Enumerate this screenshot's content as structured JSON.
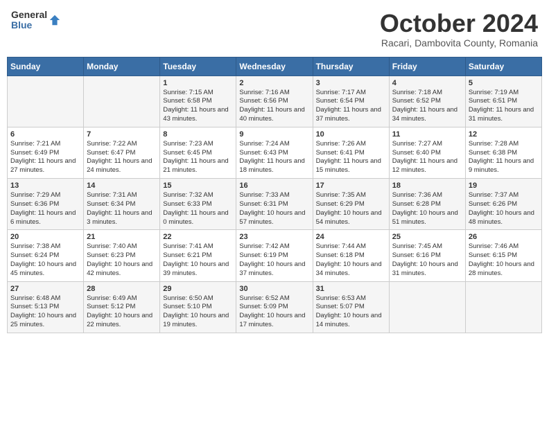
{
  "header": {
    "logo": {
      "line1": "General",
      "line2": "Blue"
    },
    "title": "October 2024",
    "subtitle": "Racari, Dambovita County, Romania"
  },
  "weekdays": [
    "Sunday",
    "Monday",
    "Tuesday",
    "Wednesday",
    "Thursday",
    "Friday",
    "Saturday"
  ],
  "weeks": [
    [
      {
        "day": "",
        "content": ""
      },
      {
        "day": "",
        "content": ""
      },
      {
        "day": "1",
        "content": "Sunrise: 7:15 AM\nSunset: 6:58 PM\nDaylight: 11 hours and 43 minutes."
      },
      {
        "day": "2",
        "content": "Sunrise: 7:16 AM\nSunset: 6:56 PM\nDaylight: 11 hours and 40 minutes."
      },
      {
        "day": "3",
        "content": "Sunrise: 7:17 AM\nSunset: 6:54 PM\nDaylight: 11 hours and 37 minutes."
      },
      {
        "day": "4",
        "content": "Sunrise: 7:18 AM\nSunset: 6:52 PM\nDaylight: 11 hours and 34 minutes."
      },
      {
        "day": "5",
        "content": "Sunrise: 7:19 AM\nSunset: 6:51 PM\nDaylight: 11 hours and 31 minutes."
      }
    ],
    [
      {
        "day": "6",
        "content": "Sunrise: 7:21 AM\nSunset: 6:49 PM\nDaylight: 11 hours and 27 minutes."
      },
      {
        "day": "7",
        "content": "Sunrise: 7:22 AM\nSunset: 6:47 PM\nDaylight: 11 hours and 24 minutes."
      },
      {
        "day": "8",
        "content": "Sunrise: 7:23 AM\nSunset: 6:45 PM\nDaylight: 11 hours and 21 minutes."
      },
      {
        "day": "9",
        "content": "Sunrise: 7:24 AM\nSunset: 6:43 PM\nDaylight: 11 hours and 18 minutes."
      },
      {
        "day": "10",
        "content": "Sunrise: 7:26 AM\nSunset: 6:41 PM\nDaylight: 11 hours and 15 minutes."
      },
      {
        "day": "11",
        "content": "Sunrise: 7:27 AM\nSunset: 6:40 PM\nDaylight: 11 hours and 12 minutes."
      },
      {
        "day": "12",
        "content": "Sunrise: 7:28 AM\nSunset: 6:38 PM\nDaylight: 11 hours and 9 minutes."
      }
    ],
    [
      {
        "day": "13",
        "content": "Sunrise: 7:29 AM\nSunset: 6:36 PM\nDaylight: 11 hours and 6 minutes."
      },
      {
        "day": "14",
        "content": "Sunrise: 7:31 AM\nSunset: 6:34 PM\nDaylight: 11 hours and 3 minutes."
      },
      {
        "day": "15",
        "content": "Sunrise: 7:32 AM\nSunset: 6:33 PM\nDaylight: 11 hours and 0 minutes."
      },
      {
        "day": "16",
        "content": "Sunrise: 7:33 AM\nSunset: 6:31 PM\nDaylight: 10 hours and 57 minutes."
      },
      {
        "day": "17",
        "content": "Sunrise: 7:35 AM\nSunset: 6:29 PM\nDaylight: 10 hours and 54 minutes."
      },
      {
        "day": "18",
        "content": "Sunrise: 7:36 AM\nSunset: 6:28 PM\nDaylight: 10 hours and 51 minutes."
      },
      {
        "day": "19",
        "content": "Sunrise: 7:37 AM\nSunset: 6:26 PM\nDaylight: 10 hours and 48 minutes."
      }
    ],
    [
      {
        "day": "20",
        "content": "Sunrise: 7:38 AM\nSunset: 6:24 PM\nDaylight: 10 hours and 45 minutes."
      },
      {
        "day": "21",
        "content": "Sunrise: 7:40 AM\nSunset: 6:23 PM\nDaylight: 10 hours and 42 minutes."
      },
      {
        "day": "22",
        "content": "Sunrise: 7:41 AM\nSunset: 6:21 PM\nDaylight: 10 hours and 39 minutes."
      },
      {
        "day": "23",
        "content": "Sunrise: 7:42 AM\nSunset: 6:19 PM\nDaylight: 10 hours and 37 minutes."
      },
      {
        "day": "24",
        "content": "Sunrise: 7:44 AM\nSunset: 6:18 PM\nDaylight: 10 hours and 34 minutes."
      },
      {
        "day": "25",
        "content": "Sunrise: 7:45 AM\nSunset: 6:16 PM\nDaylight: 10 hours and 31 minutes."
      },
      {
        "day": "26",
        "content": "Sunrise: 7:46 AM\nSunset: 6:15 PM\nDaylight: 10 hours and 28 minutes."
      }
    ],
    [
      {
        "day": "27",
        "content": "Sunrise: 6:48 AM\nSunset: 5:13 PM\nDaylight: 10 hours and 25 minutes."
      },
      {
        "day": "28",
        "content": "Sunrise: 6:49 AM\nSunset: 5:12 PM\nDaylight: 10 hours and 22 minutes."
      },
      {
        "day": "29",
        "content": "Sunrise: 6:50 AM\nSunset: 5:10 PM\nDaylight: 10 hours and 19 minutes."
      },
      {
        "day": "30",
        "content": "Sunrise: 6:52 AM\nSunset: 5:09 PM\nDaylight: 10 hours and 17 minutes."
      },
      {
        "day": "31",
        "content": "Sunrise: 6:53 AM\nSunset: 5:07 PM\nDaylight: 10 hours and 14 minutes."
      },
      {
        "day": "",
        "content": ""
      },
      {
        "day": "",
        "content": ""
      }
    ]
  ]
}
